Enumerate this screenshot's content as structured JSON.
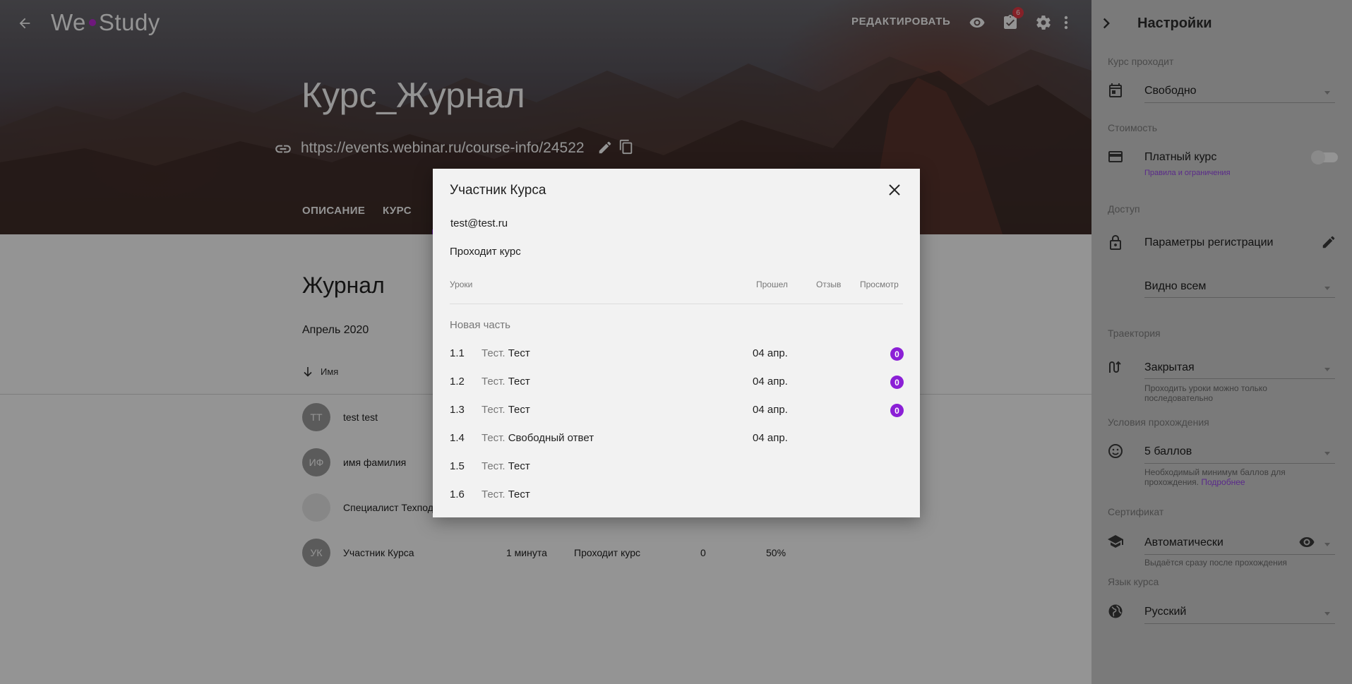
{
  "header": {
    "logo_left": "We",
    "logo_right": "Study",
    "edit_label": "РЕДАКТИРОВАТЬ",
    "tasks_badge": "6"
  },
  "course": {
    "title": "Курс_Журнал",
    "url": "https://events.webinar.ru/course-info/24522",
    "tabs": [
      {
        "label": "ОПИСАНИЕ"
      },
      {
        "label": "КУРС"
      }
    ]
  },
  "journal": {
    "title": "Журнал",
    "month": "Апрель 2020",
    "col_name": "Имя",
    "rows": [
      {
        "initials": "TT",
        "name": "test test"
      },
      {
        "initials": "ИФ",
        "name": "имя фамилия"
      },
      {
        "initials": "",
        "name": "Специалист Техпод"
      },
      {
        "initials": "УК",
        "name": "Участник Курса",
        "time": "1 минута",
        "status": "Проходит курс",
        "count": "0",
        "progress": "50%"
      }
    ]
  },
  "modal": {
    "title": "Участник Курса",
    "email": "test@test.ru",
    "status": "Проходит курс",
    "columns": {
      "lessons": "Уроки",
      "passed": "Прошел",
      "review": "Отзыв",
      "view": "Просмотр"
    },
    "section": "Новая часть",
    "lessons": [
      {
        "num": "1.1",
        "prefix": "Тест.",
        "name": "Тест",
        "date": "04 апр.",
        "badge": "0"
      },
      {
        "num": "1.2",
        "prefix": "Тест.",
        "name": "Тест",
        "date": "04 апр.",
        "badge": "0"
      },
      {
        "num": "1.3",
        "prefix": "Тест.",
        "name": "Тест",
        "date": "04 апр.",
        "badge": "0"
      },
      {
        "num": "1.4",
        "prefix": "Тест.",
        "name": "Свободный ответ",
        "date": "04 апр.",
        "badge": ""
      },
      {
        "num": "1.5",
        "prefix": "Тест.",
        "name": "Тест",
        "date": "",
        "badge": ""
      },
      {
        "num": "1.6",
        "prefix": "Тест.",
        "name": "Тест",
        "date": "",
        "badge": ""
      }
    ]
  },
  "settings": {
    "title": "Настройки",
    "course_flow_label": "Курс проходит",
    "course_flow_value": "Свободно",
    "cost_label": "Стоимость",
    "paid_course": "Платный курс",
    "rules_link": "Правила и ограничения",
    "access_label": "Доступ",
    "registration": "Параметры регистрации",
    "visibility": "Видно всем",
    "trajectory_label": "Траектория",
    "trajectory_value": "Закрытая",
    "trajectory_hint": "Проходить уроки можно только последовательно",
    "conditions_label": "Условия прохождения",
    "conditions_value": "5 баллов",
    "conditions_hint": "Необходимый минимум баллов для прохождения.",
    "conditions_link": "Подробнее",
    "certificate_label": "Сертификат",
    "certificate_value": "Автоматически",
    "certificate_hint": "Выдаётся сразу после прохождения",
    "language_label": "Язык курса",
    "language_value": "Русский"
  }
}
